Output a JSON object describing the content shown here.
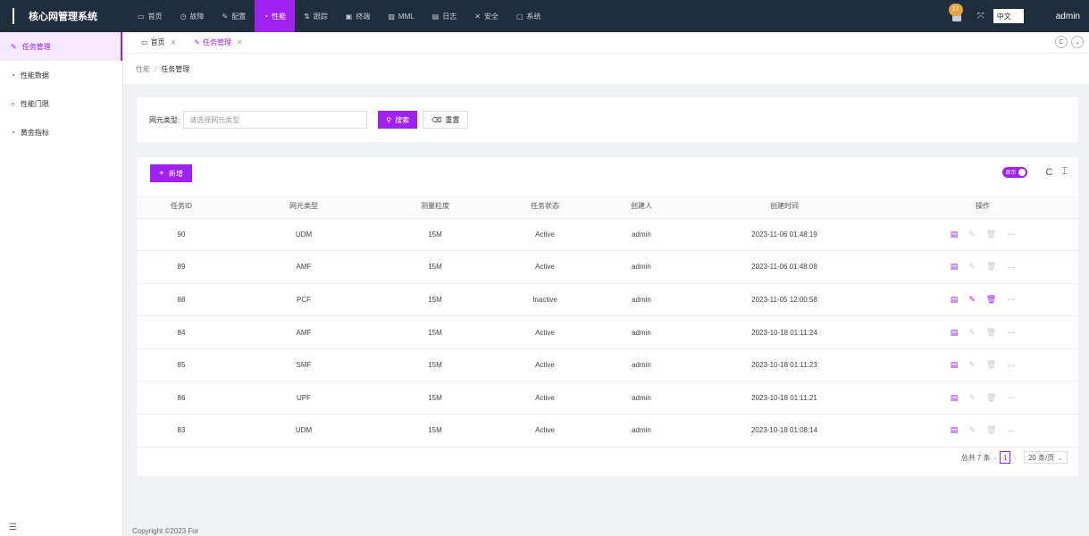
{
  "app": {
    "title": "核心网管理系统"
  },
  "topnav": [
    {
      "icon": "monitor-icon",
      "label": "首页"
    },
    {
      "icon": "clock-icon",
      "label": "故障"
    },
    {
      "icon": "edit-icon",
      "label": "配置"
    },
    {
      "icon": "dashboard-icon",
      "label": "性能"
    },
    {
      "icon": "trace-icon",
      "label": "跟踪"
    },
    {
      "icon": "terminal-icon",
      "label": "终端"
    },
    {
      "icon": "mml-icon",
      "label": "MML"
    },
    {
      "icon": "log-icon",
      "label": "日志"
    },
    {
      "icon": "shield-icon",
      "label": "安全"
    },
    {
      "icon": "system-icon",
      "label": "系统"
    }
  ],
  "header": {
    "notification_count": "17",
    "language": "中文",
    "user": "admin"
  },
  "sidebar": {
    "items": [
      {
        "icon": "edit-icon",
        "label": "任务管理"
      },
      {
        "icon": "dashboard-icon",
        "label": "性能数据"
      },
      {
        "icon": "circle-icon",
        "label": "性能门限"
      },
      {
        "icon": "dashboard-icon",
        "label": "黄金指标"
      }
    ]
  },
  "tabs": [
    {
      "icon": "monitor-icon",
      "label": "首页"
    },
    {
      "icon": "edit-icon",
      "label": "任务管理"
    }
  ],
  "breadcrumb": {
    "parent": "性能",
    "current": "任务管理"
  },
  "search": {
    "label": "网元类型:",
    "placeholder": "请选择网元类型",
    "search_button": "搜索",
    "reset_button": "重置"
  },
  "toolbar": {
    "add_button": "新增",
    "toggle_label": "显示"
  },
  "table": {
    "columns": [
      "任务ID",
      "网元类型",
      "测量粒度",
      "任务状态",
      "创建人",
      "创建时间",
      "操作"
    ],
    "rows": [
      {
        "id": "90",
        "ne": "UDM",
        "granularity": "15M",
        "status": "Active",
        "creator": "admin",
        "created": "2023-11-06 01:48:19"
      },
      {
        "id": "89",
        "ne": "AMF",
        "granularity": "15M",
        "status": "Active",
        "creator": "admin",
        "created": "2023-11-06 01:48:08"
      },
      {
        "id": "88",
        "ne": "PCF",
        "granularity": "15M",
        "status": "Inactive",
        "creator": "admin",
        "created": "2023-11-05 12:00:58"
      },
      {
        "id": "84",
        "ne": "AMF",
        "granularity": "15M",
        "status": "Active",
        "creator": "admin",
        "created": "2023-10-18 01:11:24"
      },
      {
        "id": "85",
        "ne": "SMF",
        "granularity": "15M",
        "status": "Active",
        "creator": "admin",
        "created": "2023-10-18 01:11:23"
      },
      {
        "id": "86",
        "ne": "UPF",
        "granularity": "15M",
        "status": "Active",
        "creator": "admin",
        "created": "2023-10-18 01:11:21"
      },
      {
        "id": "83",
        "ne": "UDM",
        "granularity": "15M",
        "status": "Active",
        "creator": "admin",
        "created": "2023-10-18 01:08:14"
      }
    ]
  },
  "pagination": {
    "total": "总共 7 条",
    "current_page": "1",
    "page_size": "20 条/页"
  },
  "footer": {
    "copyright": "Copyright ©2023 For"
  },
  "colors": {
    "accent": "#a020f0",
    "topbar": "#1f2d3d"
  }
}
